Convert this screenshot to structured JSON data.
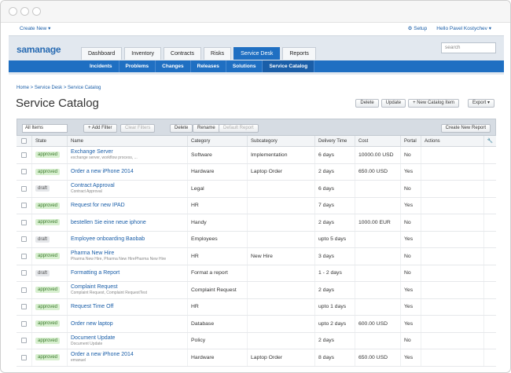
{
  "topbar": {
    "create_label": "Create New ▾",
    "setup_label": "Setup",
    "user_label": "Hello Pavel Kostychev ▾"
  },
  "header": {
    "logo": "samanage",
    "tabs": [
      {
        "label": "Dashboard"
      },
      {
        "label": "Inventory"
      },
      {
        "label": "Contracts"
      },
      {
        "label": "Risks"
      },
      {
        "label": "Service Desk"
      },
      {
        "label": "Reports"
      }
    ],
    "active_tab": 4,
    "search_placeholder": "search"
  },
  "subnav": {
    "items": [
      {
        "label": "Incidents"
      },
      {
        "label": "Problems"
      },
      {
        "label": "Changes"
      },
      {
        "label": "Releases"
      },
      {
        "label": "Solutions"
      },
      {
        "label": "Service Catalog"
      }
    ],
    "active": 5
  },
  "breadcrumb": "Home > Service Desk > Service Catalog",
  "page_title": "Service Catalog",
  "actions": {
    "delete": "Delete",
    "update": "Update",
    "new_item": "+ New Catalog Item",
    "export": "Export ▾"
  },
  "toolbar": {
    "filter_value": "All Items",
    "add_filter": "+ Add Filter",
    "clear_filters": "Clear Filters",
    "delete": "Delete",
    "rename": "Rename",
    "default_report": "Default Report",
    "create_report": "Create New Report"
  },
  "table": {
    "columns": [
      "State",
      "Name",
      "Category",
      "Subcategory",
      "Delivery Time",
      "Cost",
      "Portal",
      "Actions"
    ],
    "rows": [
      {
        "state": "approved",
        "name": "Exchange Server",
        "desc": "exchange server, workflow process, ...",
        "category": "Software",
        "subcategory": "Implementation",
        "delivery": "6 days",
        "cost": "10000.00 USD",
        "portal": "No"
      },
      {
        "state": "approved",
        "name": "Order a new iPhone 2014",
        "desc": "",
        "category": "Hardware",
        "subcategory": "Laptop Order",
        "delivery": "2 days",
        "cost": "650.00 USD",
        "portal": "Yes"
      },
      {
        "state": "draft",
        "name": "Contract Approval",
        "desc": "Contract Approval",
        "category": "Legal",
        "subcategory": "",
        "delivery": "6 days",
        "cost": "",
        "portal": "No"
      },
      {
        "state": "approved",
        "name": "Request for new IPAD",
        "desc": "",
        "category": "HR",
        "subcategory": "",
        "delivery": "7 days",
        "cost": "",
        "portal": "Yes"
      },
      {
        "state": "approved",
        "name": "bestellen Sie eine neue iphone",
        "desc": "",
        "category": "Handy",
        "subcategory": "",
        "delivery": "2 days",
        "cost": "1000.00 EUR",
        "portal": "No"
      },
      {
        "state": "draft",
        "name": "Employee onboarding Baobab",
        "desc": "",
        "category": "Employees",
        "subcategory": "",
        "delivery": "upto 5 days",
        "cost": "",
        "portal": "Yes"
      },
      {
        "state": "approved",
        "name": "Pharma New Hire",
        "desc": "Pharma New Hire, Pharma New HirePharma New Hire",
        "category": "HR",
        "subcategory": "New Hire",
        "delivery": "3 days",
        "cost": "",
        "portal": "No"
      },
      {
        "state": "draft",
        "name": "Formatting a Report",
        "desc": "",
        "category": "Format a report",
        "subcategory": "",
        "delivery": "1 - 2 days",
        "cost": "",
        "portal": "No"
      },
      {
        "state": "approved",
        "name": "Complaint Request",
        "desc": "Complaint Request, Complaint RequestTest",
        "category": "Complaint Request",
        "subcategory": "",
        "delivery": "2 days",
        "cost": "",
        "portal": "Yes"
      },
      {
        "state": "approved",
        "name": "Request Time Off",
        "desc": "",
        "category": "HR",
        "subcategory": "",
        "delivery": "upto 1 days",
        "cost": "",
        "portal": "Yes"
      },
      {
        "state": "approved",
        "name": "Order new laptop",
        "desc": "",
        "category": "Database",
        "subcategory": "",
        "delivery": "upto 2 days",
        "cost": "600.00 USD",
        "portal": "Yes"
      },
      {
        "state": "approved",
        "name": "Document Update",
        "desc": "Document Update",
        "category": "Policy",
        "subcategory": "",
        "delivery": "2 days",
        "cost": "",
        "portal": "No"
      },
      {
        "state": "approved",
        "name": "Order a new iPhone 2014",
        "desc": "emanuel",
        "category": "Hardware",
        "subcategory": "Laptop Order",
        "delivery": "8 days",
        "cost": "650.00 USD",
        "portal": "Yes"
      }
    ]
  }
}
